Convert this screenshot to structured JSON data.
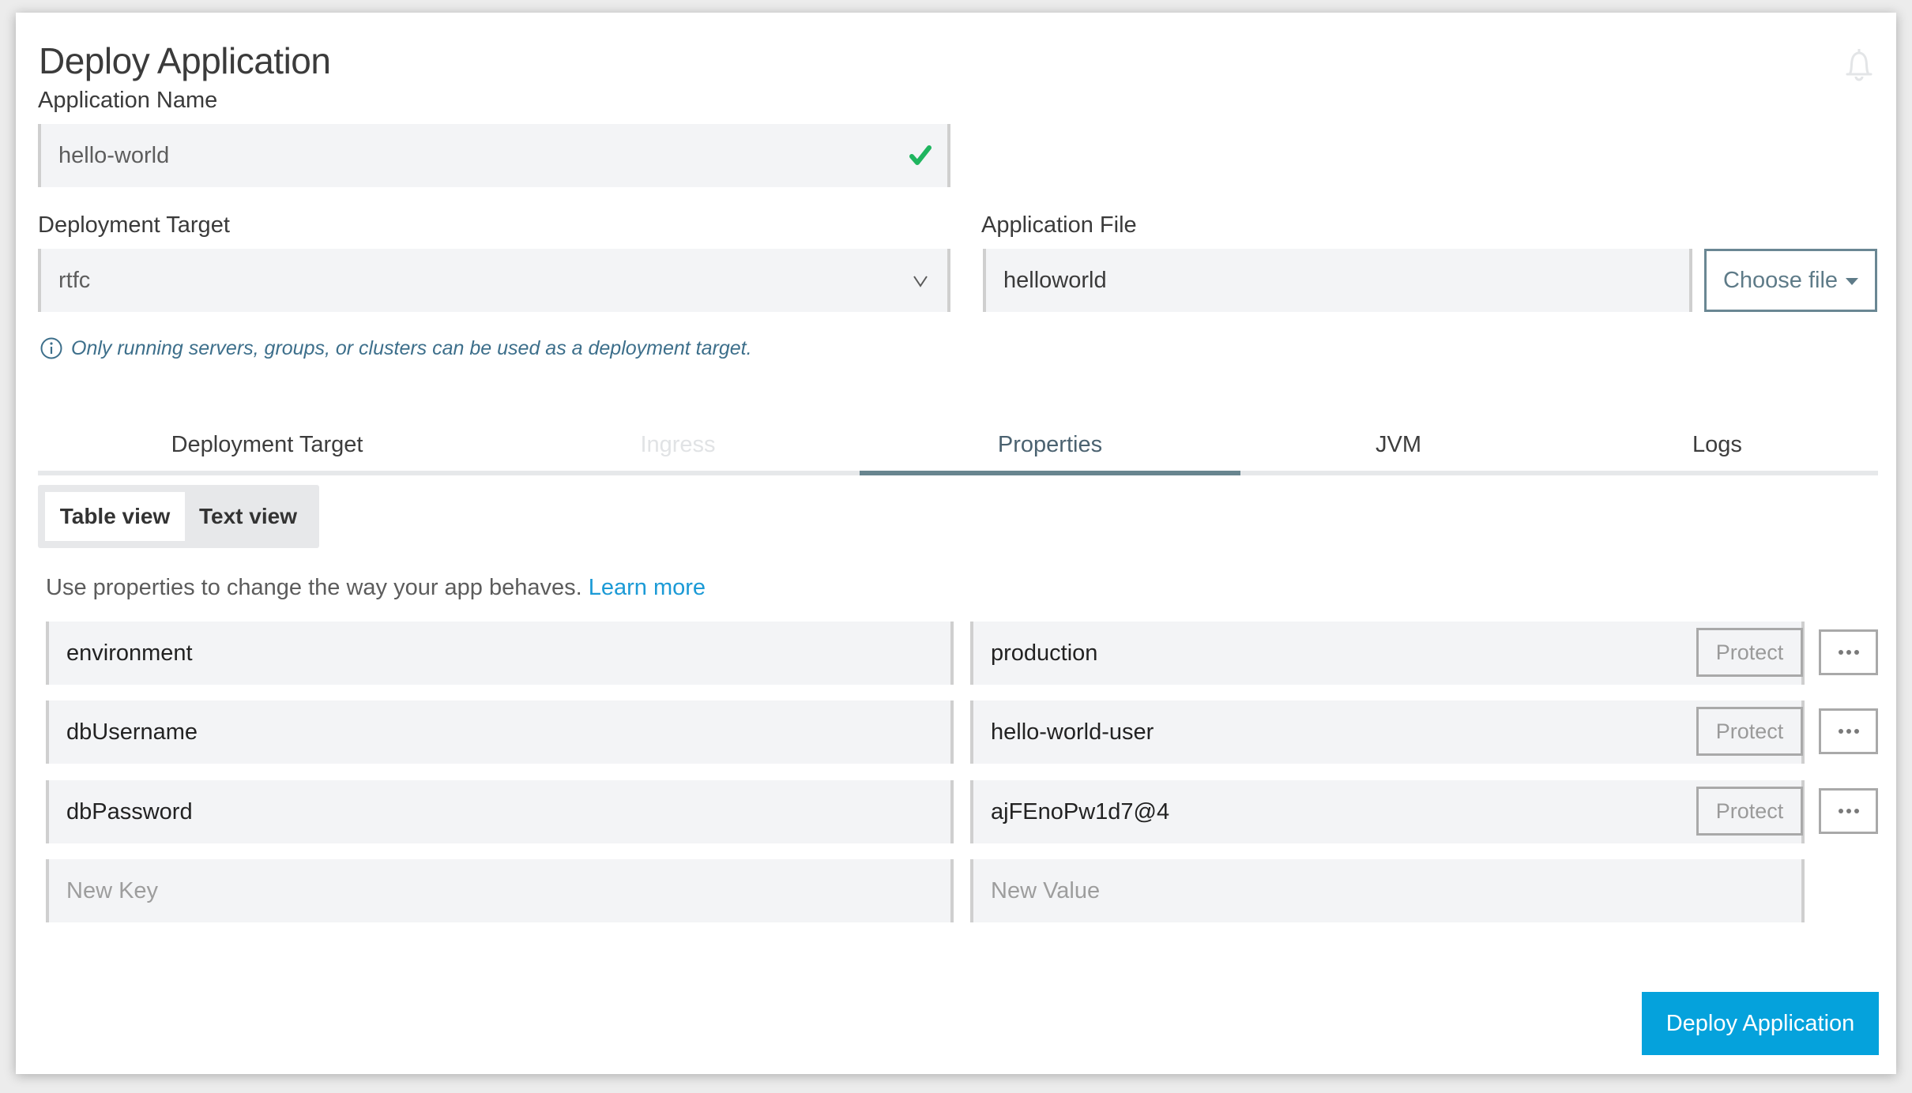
{
  "header": {
    "title": "Deploy Application",
    "notifications_icon": "bell-icon"
  },
  "app_name": {
    "label": "Application Name",
    "value": "hello-world",
    "status_icon": "check-icon",
    "status_color": "#1fb55f"
  },
  "deployment_target": {
    "label": "Deployment Target",
    "value": "rtfc",
    "icon": "chevron-down-icon"
  },
  "app_file": {
    "label": "Application File",
    "value": "helloworld",
    "choose_button": "Choose file"
  },
  "info_note": {
    "icon": "info-icon",
    "text": "Only running servers, groups, or clusters can be used as a deployment target."
  },
  "tabs": [
    {
      "label": "Deployment Target",
      "state": "normal"
    },
    {
      "label": "Ingress",
      "state": "disabled"
    },
    {
      "label": "Properties",
      "state": "active"
    },
    {
      "label": "JVM",
      "state": "normal"
    },
    {
      "label": "Logs",
      "state": "normal"
    }
  ],
  "view_toggle": {
    "options": [
      "Table view",
      "Text view"
    ],
    "selected": "Table view"
  },
  "properties": {
    "description": "Use properties to change the way your app behaves.",
    "learn_more": "Learn more",
    "protect_label": "Protect",
    "more_icon": "more-horizontal-icon",
    "rows": [
      {
        "key": "environment",
        "value": "production"
      },
      {
        "key": "dbUsername",
        "value": "hello-world-user"
      },
      {
        "key": "dbPassword",
        "value": "ajFEnoPw1d7@4"
      }
    ],
    "new_key_placeholder": "New Key",
    "new_value_placeholder": "New Value"
  },
  "footer": {
    "deploy_button": "Deploy Application"
  },
  "colors": {
    "accent": "#05a2dc",
    "tab_active": "#68858f",
    "link": "#1b9ad6",
    "info_text": "#3d6f8b",
    "success": "#1fb55f"
  }
}
